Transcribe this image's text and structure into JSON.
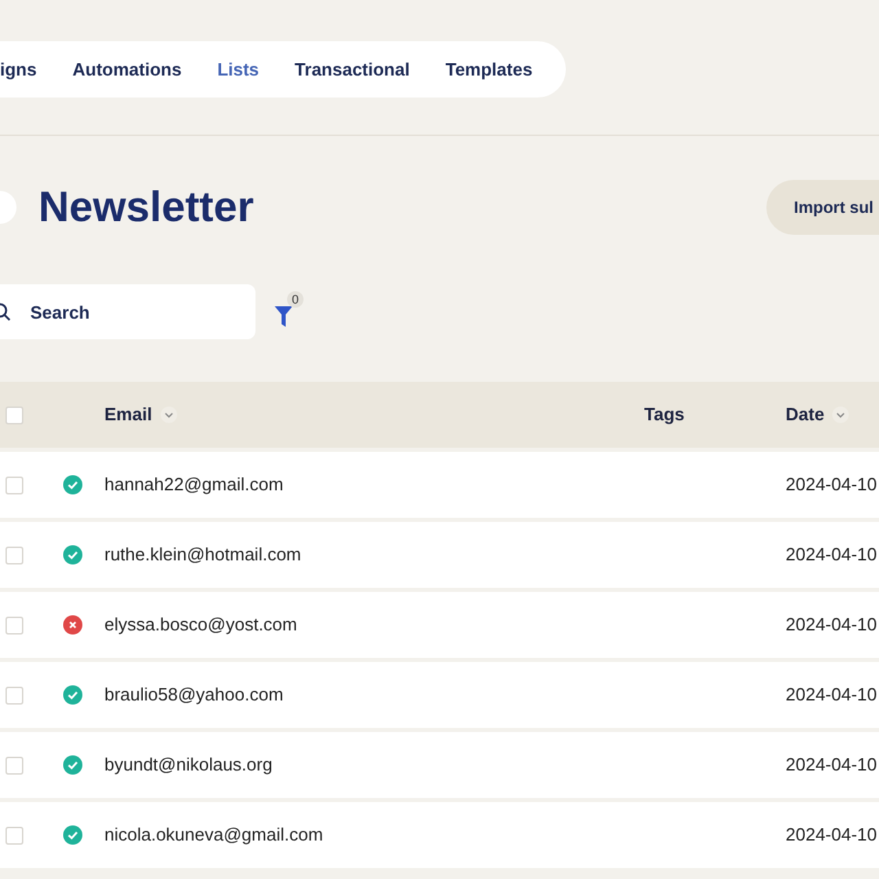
{
  "nav": {
    "tabs": [
      {
        "label": "igns",
        "selected": false
      },
      {
        "label": "Automations",
        "selected": false
      },
      {
        "label": "Lists",
        "selected": true
      },
      {
        "label": "Transactional",
        "selected": false
      },
      {
        "label": "Templates",
        "selected": false
      }
    ]
  },
  "header": {
    "title": "Newsletter",
    "import_button": "Import sul"
  },
  "search": {
    "placeholder": "Search"
  },
  "filter": {
    "count": "0"
  },
  "table": {
    "all_checked": false,
    "columns": [
      {
        "label": "Email",
        "sortable": true
      },
      {
        "label": "Tags",
        "sortable": false
      },
      {
        "label": "Date",
        "sortable": true
      }
    ],
    "rows": [
      {
        "checked": false,
        "valid": true,
        "email": "hannah22@gmail.com",
        "date": "2024-04-10"
      },
      {
        "checked": false,
        "valid": true,
        "email": "ruthe.klein@hotmail.com",
        "date": "2024-04-10"
      },
      {
        "checked": false,
        "valid": false,
        "email": "elyssa.bosco@yost.com",
        "date": "2024-04-10"
      },
      {
        "checked": false,
        "valid": true,
        "email": "braulio58@yahoo.com",
        "date": "2024-04-10"
      },
      {
        "checked": false,
        "valid": true,
        "email": "byundt@nikolaus.org",
        "date": "2024-04-10"
      },
      {
        "checked": false,
        "valid": true,
        "email": "nicola.okuneva@gmail.com",
        "date": "2024-04-10"
      }
    ]
  }
}
